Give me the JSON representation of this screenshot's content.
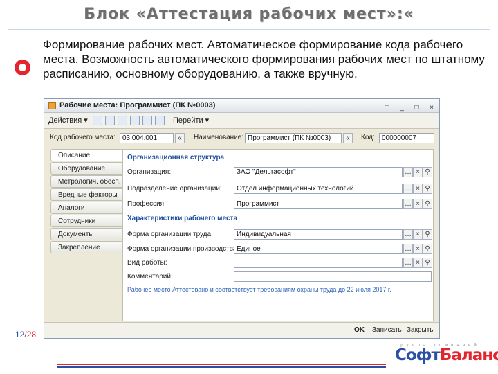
{
  "slide": {
    "title": "Блок «Аттестация рабочих мест»:«",
    "paragraph": "Формирование рабочих мест. Автоматическое формирование кода рабочего места. Возможность автоматического формирования рабочих мест по штатному расписанию, основному оборудованию, а также вручную.",
    "page_current": "12",
    "page_sep": "/",
    "page_total": "28",
    "logo_subtitle": "группа компаний",
    "logo_part1": "Софт",
    "logo_part2": "Баланс",
    "colors": {
      "accent_red": "#e3262d",
      "accent_blue": "#2b4fa3",
      "section_blue": "#1d4f9b"
    }
  },
  "window": {
    "title": "Рабочие места: Программист (ПК №0003)",
    "controls": [
      "□",
      "_",
      "□",
      "×"
    ],
    "toolbar": {
      "actions_label": "Действия ▾",
      "goto_label": "Перейти ▾",
      "icons": [
        "new-icon",
        "copy-icon",
        "edit-icon",
        "delete-icon",
        "refresh-icon",
        "document-icon"
      ]
    },
    "header": {
      "code_label": "Код рабочего места:",
      "code_value": "03.004.001",
      "name_label": "Наименование:",
      "name_value": "Программист (ПК №0003)",
      "code2_label": "Код:",
      "code2_value": "000000007",
      "nav_icon": "«"
    },
    "tabs": [
      "Описание",
      "Оборудование",
      "Метрологич. обесп.",
      "Вредные факторы",
      "Аналоги",
      "Сотрудники",
      "Документы",
      "Закрепление"
    ],
    "active_tab": 0,
    "sections": {
      "org_title": "Организационная структура",
      "org_label": "Организация:",
      "org_value": "ЗАО \"Дельтасофт\"",
      "dept_label": "Подразделение организации:",
      "dept_value": "Отдел информационных технологий",
      "prof_label": "Профессия:",
      "prof_value": "Программист",
      "char_title": "Характеристики рабочего места",
      "labor_label": "Форма организации труда:",
      "labor_value": "Индивидуальная",
      "prod_label": "Форма организации производства:",
      "prod_value": "Единое",
      "work_label": "Вид работы:",
      "work_value": "",
      "comment_label": "Комментарий:",
      "comment_value": "",
      "note": "Рабочее место Аттестовано и соответствует требованиям охраны труда до 22 июля 2017 г."
    },
    "bottom_buttons": {
      "ok": "OK",
      "save": "Записать",
      "close": "Закрыть"
    }
  }
}
